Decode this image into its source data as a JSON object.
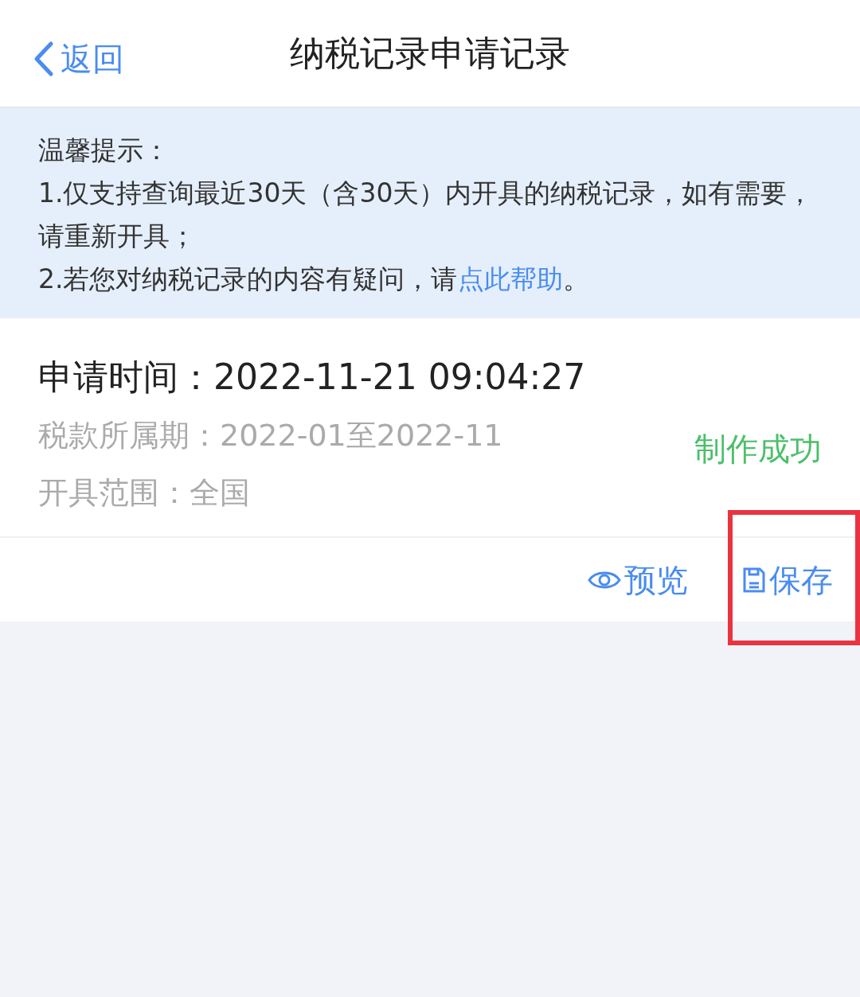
{
  "header": {
    "back": "返回",
    "title": "纳税记录申请记录"
  },
  "notice": {
    "heading": "温馨提示：",
    "items": [
      {
        "text": "1.仅支持查询最近30天（含30天）内开具的纳税记录，如有需要，请重新开具；"
      },
      {
        "text": "2.若您对纳税记录的内容有疑问，请",
        "link": "点此帮助",
        "after": "。"
      }
    ]
  },
  "record": {
    "time_label": "申请时间：",
    "time": "2022-11-21 09:04:27",
    "period_label": "税款所属期：",
    "period": "2022-01至2022-11",
    "scope_label": "开具范围：",
    "scope": "全国",
    "status": "制作成功",
    "actions": [
      {
        "kind": "preview",
        "label": "预览",
        "highlighted": false
      },
      {
        "kind": "save",
        "label": "保存",
        "highlighted": true
      }
    ]
  }
}
